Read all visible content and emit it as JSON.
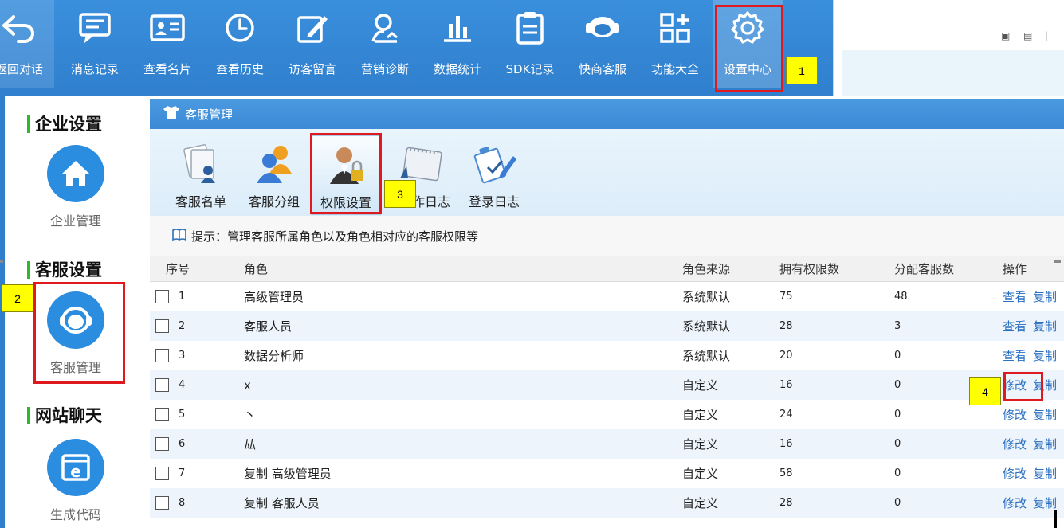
{
  "toolbar": {
    "items": [
      {
        "label": "返回对话",
        "icon": "back-arrow-icon"
      },
      {
        "label": "消息记录",
        "icon": "message-record-icon"
      },
      {
        "label": "查看名片",
        "icon": "business-card-icon"
      },
      {
        "label": "查看历史",
        "icon": "history-clock-icon"
      },
      {
        "label": "访客留言",
        "icon": "edit-message-icon"
      },
      {
        "label": "营销诊断",
        "icon": "diagnosis-icon"
      },
      {
        "label": "数据统计",
        "icon": "bar-chart-icon"
      },
      {
        "label": "SDK记录",
        "icon": "clipboard-icon"
      },
      {
        "label": "快商客服",
        "icon": "support-agent-icon"
      },
      {
        "label": "功能大全",
        "icon": "feature-grid-icon"
      },
      {
        "label": "设置中心",
        "icon": "gear-icon"
      }
    ],
    "active": "设置中心"
  },
  "sidebar": {
    "sections": [
      {
        "title": "企业设置",
        "item_label": "企业管理",
        "icon": "home-icon"
      },
      {
        "title": "客服设置",
        "item_label": "客服管理",
        "icon": "headset-icon"
      },
      {
        "title": "网站聊天",
        "item_label": "生成代码",
        "icon": "browser-e-icon"
      }
    ]
  },
  "panel": {
    "title": "客服管理",
    "tabs": [
      {
        "label": "客服名单",
        "icon": "staff-list-icon"
      },
      {
        "label": "客服分组",
        "icon": "group-users-icon"
      },
      {
        "label": "权限设置",
        "icon": "permission-lock-icon"
      },
      {
        "label": "操作日志",
        "label_visible": "作日志",
        "icon": "calendar-log-icon"
      },
      {
        "label": "登录日志",
        "icon": "login-log-icon"
      }
    ],
    "active_tab": "权限设置",
    "hint": "提示：管理客服所属角色以及角色相对应的客服权限等"
  },
  "table": {
    "columns": [
      "序号",
      "角色",
      "角色来源",
      "拥有权限数",
      "分配客服数",
      "操作"
    ],
    "rows": [
      {
        "no": "1",
        "role": "高级管理员",
        "source": "系统默认",
        "perms": "75",
        "staff": "48",
        "op1": "查看",
        "op2": "复制"
      },
      {
        "no": "2",
        "role": "客服人员",
        "source": "系统默认",
        "perms": "28",
        "staff": "3",
        "op1": "查看",
        "op2": "复制"
      },
      {
        "no": "3",
        "role": "数据分析师",
        "source": "系统默认",
        "perms": "20",
        "staff": "0",
        "op1": "查看",
        "op2": "复制"
      },
      {
        "no": "4",
        "role": "x",
        "source": "自定义",
        "perms": "16",
        "staff": "0",
        "op1": "修改",
        "op2": "复制"
      },
      {
        "no": "5",
        "role": "丶",
        "source": "自定义",
        "perms": "24",
        "staff": "0",
        "op1": "修改",
        "op2": "复制"
      },
      {
        "no": "6",
        "role": "厸",
        "source": "自定义",
        "perms": "16",
        "staff": "0",
        "op1": "修改",
        "op2": "复制"
      },
      {
        "no": "7",
        "role": "复制 高级管理员",
        "source": "自定义",
        "perms": "58",
        "staff": "0",
        "op1": "修改",
        "op2": "复制"
      },
      {
        "no": "8",
        "role": "复制 客服人员",
        "source": "自定义",
        "perms": "28",
        "staff": "0",
        "op1": "修改",
        "op2": "复制"
      }
    ]
  },
  "annotations": {
    "callouts": [
      "1",
      "2",
      "3",
      "4"
    ],
    "highlight_color": "#e0191f",
    "callout_color": "#ffff00"
  },
  "colors": {
    "toolbar_blue": "#2f7fcd",
    "link_blue": "#2a70c2",
    "section_bar_green": "#2db82d",
    "icon_circle_blue": "#2b8de0"
  }
}
